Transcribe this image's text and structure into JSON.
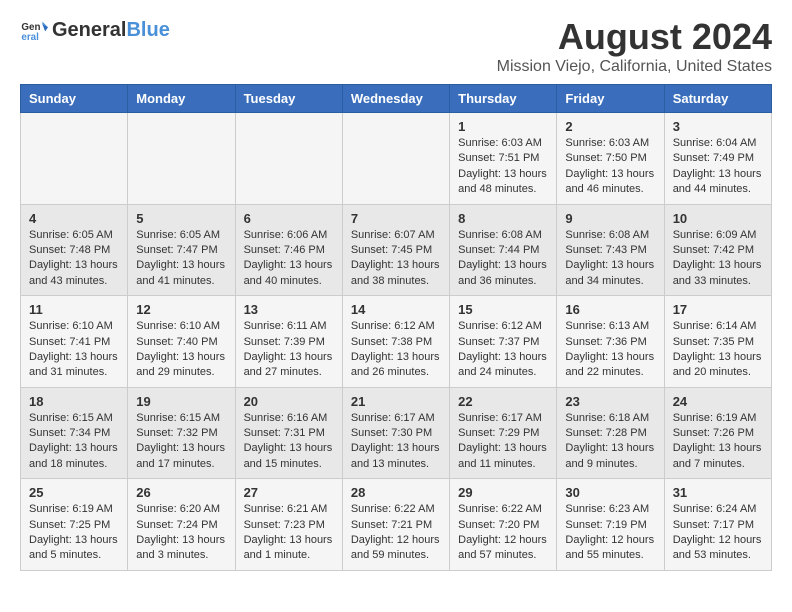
{
  "header": {
    "logo_general": "General",
    "logo_blue": "Blue",
    "month_year": "August 2024",
    "location": "Mission Viejo, California, United States"
  },
  "weekdays": [
    "Sunday",
    "Monday",
    "Tuesday",
    "Wednesday",
    "Thursday",
    "Friday",
    "Saturday"
  ],
  "weeks": [
    [
      {
        "day": "",
        "content": ""
      },
      {
        "day": "",
        "content": ""
      },
      {
        "day": "",
        "content": ""
      },
      {
        "day": "",
        "content": ""
      },
      {
        "day": "1",
        "content": "Sunrise: 6:03 AM\nSunset: 7:51 PM\nDaylight: 13 hours\nand 48 minutes."
      },
      {
        "day": "2",
        "content": "Sunrise: 6:03 AM\nSunset: 7:50 PM\nDaylight: 13 hours\nand 46 minutes."
      },
      {
        "day": "3",
        "content": "Sunrise: 6:04 AM\nSunset: 7:49 PM\nDaylight: 13 hours\nand 44 minutes."
      }
    ],
    [
      {
        "day": "4",
        "content": "Sunrise: 6:05 AM\nSunset: 7:48 PM\nDaylight: 13 hours\nand 43 minutes."
      },
      {
        "day": "5",
        "content": "Sunrise: 6:05 AM\nSunset: 7:47 PM\nDaylight: 13 hours\nand 41 minutes."
      },
      {
        "day": "6",
        "content": "Sunrise: 6:06 AM\nSunset: 7:46 PM\nDaylight: 13 hours\nand 40 minutes."
      },
      {
        "day": "7",
        "content": "Sunrise: 6:07 AM\nSunset: 7:45 PM\nDaylight: 13 hours\nand 38 minutes."
      },
      {
        "day": "8",
        "content": "Sunrise: 6:08 AM\nSunset: 7:44 PM\nDaylight: 13 hours\nand 36 minutes."
      },
      {
        "day": "9",
        "content": "Sunrise: 6:08 AM\nSunset: 7:43 PM\nDaylight: 13 hours\nand 34 minutes."
      },
      {
        "day": "10",
        "content": "Sunrise: 6:09 AM\nSunset: 7:42 PM\nDaylight: 13 hours\nand 33 minutes."
      }
    ],
    [
      {
        "day": "11",
        "content": "Sunrise: 6:10 AM\nSunset: 7:41 PM\nDaylight: 13 hours\nand 31 minutes."
      },
      {
        "day": "12",
        "content": "Sunrise: 6:10 AM\nSunset: 7:40 PM\nDaylight: 13 hours\nand 29 minutes."
      },
      {
        "day": "13",
        "content": "Sunrise: 6:11 AM\nSunset: 7:39 PM\nDaylight: 13 hours\nand 27 minutes."
      },
      {
        "day": "14",
        "content": "Sunrise: 6:12 AM\nSunset: 7:38 PM\nDaylight: 13 hours\nand 26 minutes."
      },
      {
        "day": "15",
        "content": "Sunrise: 6:12 AM\nSunset: 7:37 PM\nDaylight: 13 hours\nand 24 minutes."
      },
      {
        "day": "16",
        "content": "Sunrise: 6:13 AM\nSunset: 7:36 PM\nDaylight: 13 hours\nand 22 minutes."
      },
      {
        "day": "17",
        "content": "Sunrise: 6:14 AM\nSunset: 7:35 PM\nDaylight: 13 hours\nand 20 minutes."
      }
    ],
    [
      {
        "day": "18",
        "content": "Sunrise: 6:15 AM\nSunset: 7:34 PM\nDaylight: 13 hours\nand 18 minutes."
      },
      {
        "day": "19",
        "content": "Sunrise: 6:15 AM\nSunset: 7:32 PM\nDaylight: 13 hours\nand 17 minutes."
      },
      {
        "day": "20",
        "content": "Sunrise: 6:16 AM\nSunset: 7:31 PM\nDaylight: 13 hours\nand 15 minutes."
      },
      {
        "day": "21",
        "content": "Sunrise: 6:17 AM\nSunset: 7:30 PM\nDaylight: 13 hours\nand 13 minutes."
      },
      {
        "day": "22",
        "content": "Sunrise: 6:17 AM\nSunset: 7:29 PM\nDaylight: 13 hours\nand 11 minutes."
      },
      {
        "day": "23",
        "content": "Sunrise: 6:18 AM\nSunset: 7:28 PM\nDaylight: 13 hours\nand 9 minutes."
      },
      {
        "day": "24",
        "content": "Sunrise: 6:19 AM\nSunset: 7:26 PM\nDaylight: 13 hours\nand 7 minutes."
      }
    ],
    [
      {
        "day": "25",
        "content": "Sunrise: 6:19 AM\nSunset: 7:25 PM\nDaylight: 13 hours\nand 5 minutes."
      },
      {
        "day": "26",
        "content": "Sunrise: 6:20 AM\nSunset: 7:24 PM\nDaylight: 13 hours\nand 3 minutes."
      },
      {
        "day": "27",
        "content": "Sunrise: 6:21 AM\nSunset: 7:23 PM\nDaylight: 13 hours\nand 1 minute."
      },
      {
        "day": "28",
        "content": "Sunrise: 6:22 AM\nSunset: 7:21 PM\nDaylight: 12 hours\nand 59 minutes."
      },
      {
        "day": "29",
        "content": "Sunrise: 6:22 AM\nSunset: 7:20 PM\nDaylight: 12 hours\nand 57 minutes."
      },
      {
        "day": "30",
        "content": "Sunrise: 6:23 AM\nSunset: 7:19 PM\nDaylight: 12 hours\nand 55 minutes."
      },
      {
        "day": "31",
        "content": "Sunrise: 6:24 AM\nSunset: 7:17 PM\nDaylight: 12 hours\nand 53 minutes."
      }
    ]
  ]
}
